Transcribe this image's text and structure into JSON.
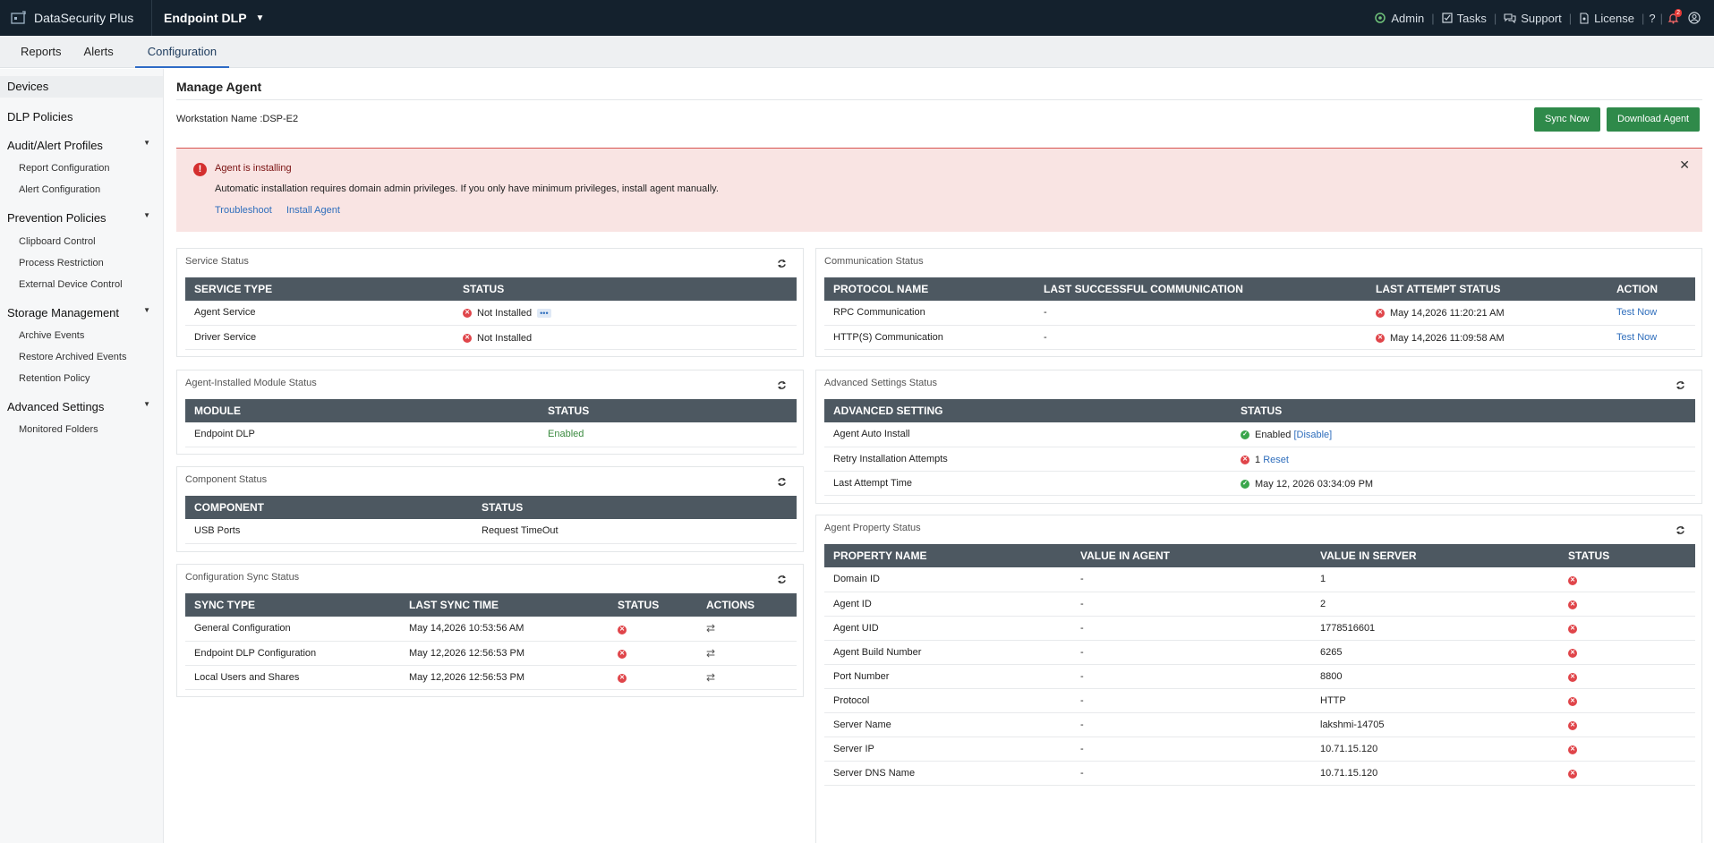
{
  "topbar": {
    "brand": "DataSecurity Plus",
    "product": "Endpoint DLP",
    "links": {
      "admin": "Admin",
      "tasks": "Tasks",
      "support": "Support",
      "license": "License"
    },
    "help": "?",
    "notif_count": "2"
  },
  "tabs": [
    "Reports",
    "Alerts",
    "Configuration"
  ],
  "sidebar": {
    "devices": "Devices",
    "dlp_policies": "DLP Policies",
    "audit_alert_profiles": "Audit/Alert Profiles",
    "audit_items": [
      "Report Configuration",
      "Alert Configuration"
    ],
    "prevention_policies": "Prevention Policies",
    "prevention_items": [
      "Clipboard Control",
      "Process Restriction",
      "External Device Control"
    ],
    "storage_management": "Storage Management",
    "storage_items": [
      "Archive Events",
      "Restore Archived Events",
      "Retention Policy"
    ],
    "advanced_settings": "Advanced Settings",
    "advanced_items": [
      "Monitored Folders"
    ]
  },
  "page": {
    "title": "Manage Agent",
    "workstation": "Workstation Name :DSP-E2",
    "sync_now": "Sync Now",
    "download_agent": "Download Agent"
  },
  "alert": {
    "title": "Agent is installing",
    "message": "Automatic installation requires domain admin privileges. If you only have minimum privileges, install agent manually.",
    "troubleshoot": "Troubleshoot",
    "install_agent": "Install Agent"
  },
  "service_status": {
    "title": "Service Status",
    "headers": [
      "SERVICE TYPE",
      "STATUS"
    ],
    "rows": [
      {
        "type": "Agent Service",
        "status": "Not Installed"
      },
      {
        "type": "Driver Service",
        "status": "Not Installed"
      }
    ]
  },
  "module_status": {
    "title": "Agent-Installed Module Status",
    "headers": [
      "MODULE",
      "STATUS"
    ],
    "rows": [
      {
        "module": "Endpoint DLP",
        "status": "Enabled"
      }
    ]
  },
  "component_status": {
    "title": "Component Status",
    "headers": [
      "COMPONENT",
      "STATUS"
    ],
    "rows": [
      {
        "component": "USB Ports",
        "status": "Request TimeOut"
      }
    ]
  },
  "config_sync": {
    "title": "Configuration Sync Status",
    "headers": [
      "SYNC TYPE",
      "LAST SYNC TIME",
      "STATUS",
      "ACTIONS"
    ],
    "rows": [
      {
        "type": "General Configuration",
        "time": "May 14,2026 10:53:56 AM"
      },
      {
        "type": "Endpoint DLP Configuration",
        "time": "May 12,2026 12:56:53 PM"
      },
      {
        "type": "Local Users and Shares",
        "time": "May 12,2026 12:56:53 PM"
      }
    ]
  },
  "communication": {
    "title": "Communication Status",
    "headers": [
      "PROTOCOL NAME",
      "LAST SUCCESSFUL COMMUNICATION",
      "LAST ATTEMPT STATUS",
      "ACTION"
    ],
    "rows": [
      {
        "protocol": "RPC Communication",
        "last": "-",
        "attempt": "May 14,2026 11:20:21 AM",
        "action": "Test Now"
      },
      {
        "protocol": "HTTP(S) Communication",
        "last": "-",
        "attempt": "May 14,2026 11:09:58 AM",
        "action": "Test Now"
      }
    ]
  },
  "advanced_status": {
    "title": "Advanced Settings Status",
    "headers": [
      "ADVANCED SETTING",
      "STATUS"
    ],
    "rows": [
      {
        "setting": "Agent Auto Install",
        "status": "Enabled",
        "link": "[Disable]"
      },
      {
        "setting": "Retry Installation Attempts",
        "status": "1",
        "link": "Reset"
      },
      {
        "setting": "Last Attempt Time",
        "status": "May 12, 2026 03:34:09 PM",
        "link": ""
      }
    ]
  },
  "property_status": {
    "title": "Agent Property Status",
    "headers": [
      "PROPERTY NAME",
      "VALUE IN AGENT",
      "VALUE IN SERVER",
      "STATUS"
    ],
    "rows": [
      {
        "name": "Domain ID",
        "agent": "-",
        "server": "1"
      },
      {
        "name": "Agent ID",
        "agent": "-",
        "server": "2"
      },
      {
        "name": "Agent UID",
        "agent": "-",
        "server": "1778516601"
      },
      {
        "name": "Agent Build Number",
        "agent": "-",
        "server": "6265"
      },
      {
        "name": "Port Number",
        "agent": "-",
        "server": "8800"
      },
      {
        "name": "Protocol",
        "agent": "-",
        "server": "HTTP"
      },
      {
        "name": "Server Name",
        "agent": "-",
        "server": "lakshmi-14705"
      },
      {
        "name": "Server IP",
        "agent": "-",
        "server": "10.71.15.120"
      },
      {
        "name": "Server DNS Name",
        "agent": "-",
        "server": "10.71.15.120"
      }
    ]
  },
  "icons": {
    "refresh": "refresh-icon",
    "error": "error-circle-icon",
    "success": "check-circle-icon",
    "sync": "sync-arrows-icon"
  },
  "colors": {
    "topbar": "#14212d",
    "accent": "#2f8a4a",
    "error": "#e0454a",
    "link": "#2f6ebc",
    "table_header": "#4d5861",
    "alert_bg": "#f9e4e3"
  }
}
